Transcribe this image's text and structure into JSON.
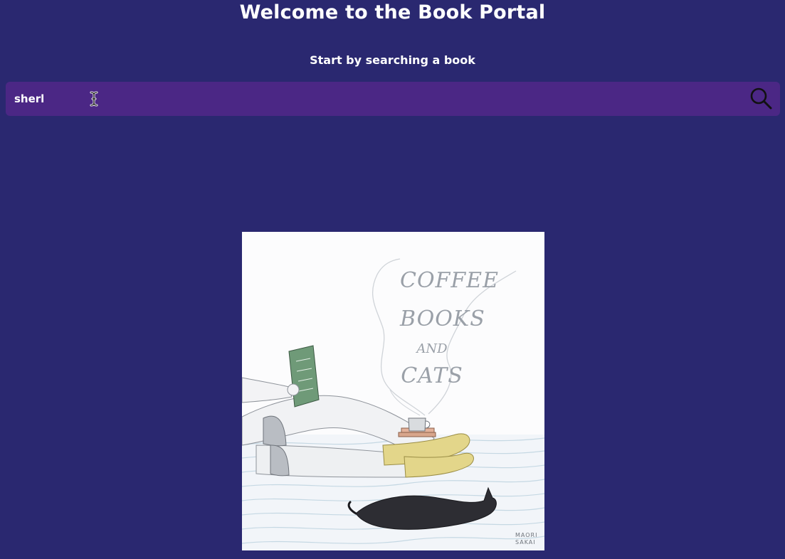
{
  "header": {
    "title": "Welcome to the Book Portal",
    "subtitle": "Start by searching a book"
  },
  "search": {
    "value": "sherl",
    "placeholder": "",
    "button_icon": "search-icon"
  },
  "illustration": {
    "icon": "book-cafe-illustration",
    "lettering": [
      "COFFEE",
      "BOOKS",
      "AND",
      "CATS"
    ],
    "book_cover_lettering": [
      "COFFEE",
      "BOOKS",
      "AND",
      "CATS"
    ],
    "signature": [
      "MAORI",
      "SAKAI"
    ]
  },
  "colors": {
    "background": "#2a2870",
    "search_bar": "#4b2785",
    "text": "#ffffff"
  }
}
